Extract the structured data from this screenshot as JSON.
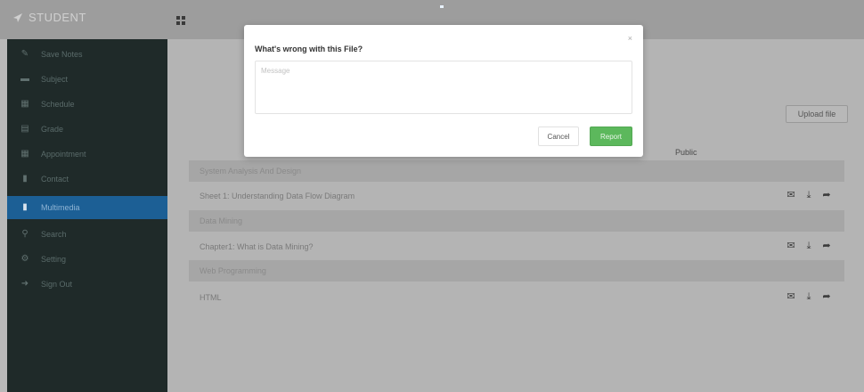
{
  "brand": {
    "label": "STUDENT",
    "icon": "paper-plane-icon"
  },
  "sidebar": {
    "items": [
      {
        "label": "Save Notes",
        "icon": "pencil-square-icon",
        "active": false
      },
      {
        "label": "Subject",
        "icon": "book-icon",
        "active": false
      },
      {
        "label": "Schedule",
        "icon": "calendar-icon",
        "active": false
      },
      {
        "label": "Grade",
        "icon": "grade-card-icon",
        "active": false
      },
      {
        "label": "Appointment",
        "icon": "calendar-check-icon",
        "active": false
      },
      {
        "label": "Contact",
        "icon": "address-book-icon",
        "active": false
      },
      {
        "label": "Multimedia",
        "icon": "file-icon",
        "active": true
      },
      {
        "label": "Search",
        "icon": "search-icon",
        "active": false
      },
      {
        "label": "Setting",
        "icon": "gear-icon",
        "active": false
      },
      {
        "label": "Sign Out",
        "icon": "sign-out-icon",
        "active": false
      }
    ]
  },
  "main": {
    "upload_label": "Upload file",
    "public_header": "Public",
    "groups": [
      {
        "title": "System Analysis And Design",
        "files": [
          "Sheet 1: Understanding Data Flow Diagram"
        ]
      },
      {
        "title": "Data Mining",
        "files": [
          "Chapter1: What is Data Mining?"
        ]
      },
      {
        "title": "Web Programming",
        "files": [
          "HTML"
        ]
      }
    ]
  },
  "modal": {
    "title": "What's wrong with this File?",
    "close": "×",
    "placeholder": "Message",
    "cancel_label": "Cancel",
    "report_label": "Report"
  },
  "colors": {
    "active_nav": "#1c5f95",
    "report_button": "#5cb85c",
    "sidebar_bg": "#1f2a29"
  }
}
